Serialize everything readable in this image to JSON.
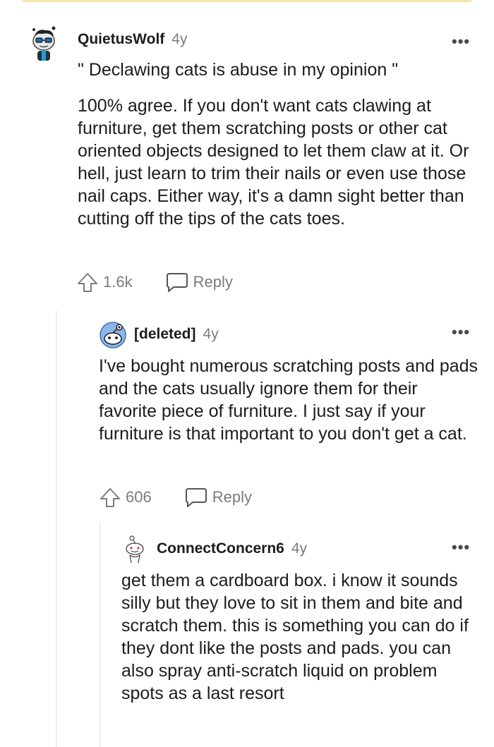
{
  "comments": [
    {
      "author": "QuietusWolf",
      "age": "4y",
      "quote": "\" Declawing cats is abuse in my opinion \"",
      "body": "100% agree. If you don't want cats clawing at furniture, get them scratching posts or other cat oriented objects designed to let them claw at it. Or hell, just learn to trim their nails or even use those nail caps. Either way, it's a damn sight better than cutting off the tips of the cats toes.",
      "votes": "1.6k",
      "reply_label": "Reply",
      "more": "•••"
    },
    {
      "author": "[deleted]",
      "age": "4y",
      "body": "I've bought numerous scratching posts and pads and the cats usually ignore them for their favorite piece of furniture. I just say if your furniture is that important to you don't get a cat.",
      "votes": "606",
      "reply_label": "Reply",
      "more": "•••"
    },
    {
      "author": "ConnectConcern6",
      "age": "4y",
      "body": "get them a cardboard box. i know it sounds silly but they love to sit in them and bite and scratch them. this is something you can do if they dont like the posts and pads. you can also spray anti-scratch liquid on problem spots as a last resort",
      "more": "•••"
    }
  ],
  "colors": {
    "text": "#1c1c1c",
    "muted": "#7c7c7c",
    "thread_line": "#edeff1",
    "top_rule": "#f2e6a6"
  }
}
